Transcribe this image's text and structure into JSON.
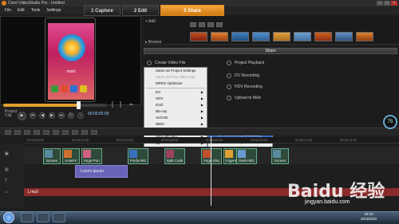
{
  "window": {
    "title": "Corel VideoStudio Pro - Untitled"
  },
  "menu": [
    "File",
    "Edit",
    "Tools",
    "Settings"
  ],
  "steps": [
    {
      "num": "1",
      "label": "Capture"
    },
    {
      "num": "2",
      "label": "Edit"
    },
    {
      "num": "3",
      "label": "Share"
    }
  ],
  "preview": {
    "phone_label": "moto",
    "project_label": "Project",
    "clip_label": "Clip",
    "timecode": "00:00:05:09",
    "progress": 0.72
  },
  "library": {
    "add": "Add",
    "browse": "Browse"
  },
  "share": {
    "header": "Share",
    "create_video_file": "Create Video File",
    "project_playback": "Project Playback",
    "dv_recording": "DV Recording",
    "hdv_recording": "HDV Recording",
    "upload_to_web": "Upload to Web"
  },
  "context_menu": {
    "items": [
      {
        "label": "Same as Project Settings",
        "state": "normal",
        "submenu": false
      },
      {
        "label": "Same as First Video Clip",
        "state": "dim",
        "submenu": false
      },
      {
        "label": "MPEG Optimizer",
        "state": "normal",
        "submenu": false
      },
      {
        "label": "DV",
        "state": "normal",
        "submenu": true
      },
      {
        "label": "HDV",
        "state": "normal",
        "submenu": true
      },
      {
        "label": "DVD",
        "state": "normal",
        "submenu": true
      },
      {
        "label": "Blu-ray",
        "state": "normal",
        "submenu": true
      },
      {
        "label": "AVCHD",
        "state": "normal",
        "submenu": true
      },
      {
        "label": "WMV",
        "state": "normal",
        "submenu": true
      },
      {
        "label": "MPEG-4",
        "state": "highlight",
        "submenu": true
      },
      {
        "label": "Ultra HD (4K)",
        "state": "normal",
        "submenu": true
      },
      {
        "label": "3D",
        "state": "normal",
        "submenu": true
      },
      {
        "label": "Custom",
        "state": "normal",
        "submenu": true
      }
    ],
    "submenu": [
      {
        "label": "MPEG-4 AVC (1920x1080)",
        "state": "highlight"
      },
      {
        "label": "MPEG-4 AVC (1280x720)",
        "state": "normal"
      },
      {
        "label": "MPEG-4 AVC (640x480)",
        "state": "normal"
      }
    ]
  },
  "timeline": {
    "clips": [
      "Screen",
      "Ansel-F",
      "Imge-Pun",
      "Pinda-Wiz",
      "Split Code",
      "Imge-Sha",
      "Imge-Blo",
      "Desh-Wiz",
      "Screen"
    ],
    "title_clip": "Lorem ipsum",
    "music_clip": "1.mp3",
    "zoom_badge": "75",
    "ruler_marks": [
      "00:00:00:00",
      "00:00:02:00",
      "00:00:04:00",
      "00:00:06:00",
      "00:00:08:00",
      "00:00:10:00",
      "00:00:12:00",
      "00:00:14:00"
    ]
  },
  "taskbar": {
    "time": "18:12",
    "date": "2015/5/20"
  },
  "watermark": {
    "brand": "Baidu 经验",
    "url": "jingyan.baidu.com"
  },
  "colors": {
    "accent": "#e08a20",
    "highlight": "#3a68c8",
    "music_track": "#8a2a2a",
    "title_track": "#6a64b8"
  }
}
